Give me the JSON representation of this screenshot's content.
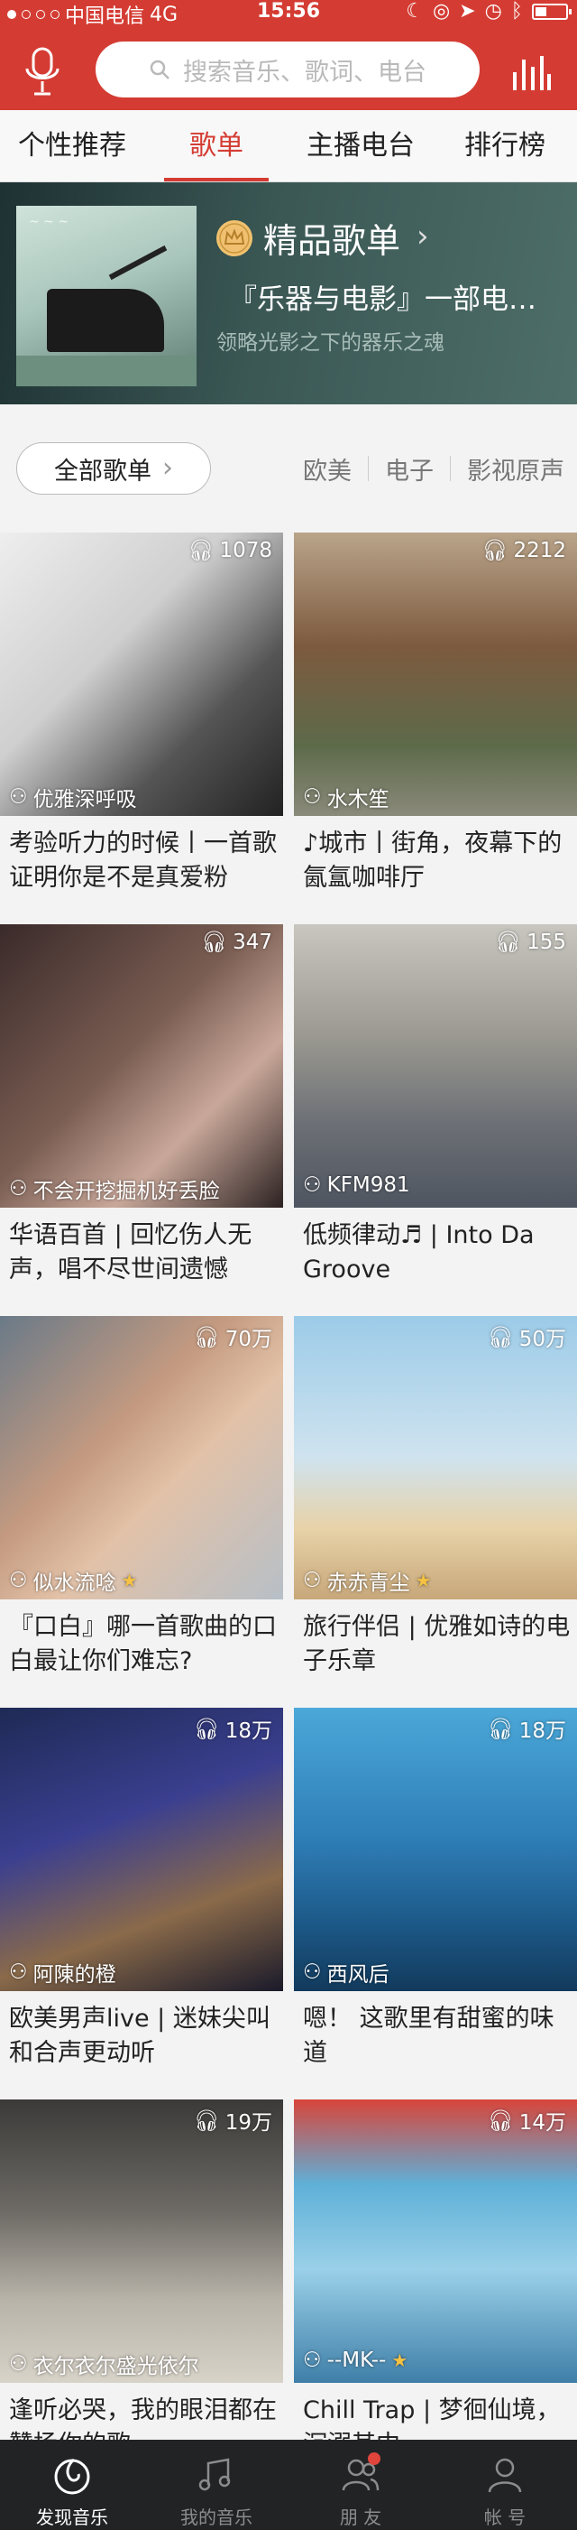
{
  "status_bar": {
    "carrier": "中国电信",
    "network": "4G",
    "time": "15:56"
  },
  "header": {
    "search_placeholder": "搜索音乐、歌词、电台",
    "accent_color": "#d43c33"
  },
  "tabs": [
    {
      "label": "个性推荐",
      "active": false
    },
    {
      "label": "歌单",
      "active": true
    },
    {
      "label": "主播电台",
      "active": false
    },
    {
      "label": "排行榜",
      "active": false
    }
  ],
  "banner": {
    "title": "精品歌单",
    "subtitle": "『乐器与电影』一部电影的声音",
    "description": "领略光影之下的器乐之魂",
    "icon": "crown-icon"
  },
  "filter": {
    "all_label": "全部歌单",
    "categories": [
      "欧美",
      "电子",
      "影视原声"
    ]
  },
  "playlists": [
    {
      "plays": "1078",
      "creator": "优雅深呼吸",
      "vip": false,
      "title": "考验听力的时候丨一首歌证明你是不是真爱粉"
    },
    {
      "plays": "2212",
      "creator": "水木笙",
      "vip": false,
      "title": "♪城市丨街角，夜幕下的氤氲咖啡厅"
    },
    {
      "plays": "347",
      "creator": "不会开挖掘机好丢脸",
      "vip": false,
      "title": "华语百首 | 回忆伤人无声，唱不尽世间遗憾"
    },
    {
      "plays": "155",
      "creator": "KFM981",
      "vip": false,
      "title": "低频律动♬ | Into Da Groove"
    },
    {
      "plays": "70万",
      "creator": "似水流唸",
      "vip": true,
      "title": "『口白』哪一首歌曲的口白最让你们难忘?"
    },
    {
      "plays": "50万",
      "creator": "赤赤青尘",
      "vip": true,
      "title": "旅行伴侣 | 优雅如诗的电子乐章"
    },
    {
      "plays": "18万",
      "creator": "阿陳的橙",
      "vip": false,
      "title": "欧美男声live | 迷妹尖叫和合声更动听"
    },
    {
      "plays": "18万",
      "creator": "西风后",
      "vip": false,
      "title": "嗯！ 这歌里有甜蜜的味道"
    },
    {
      "plays": "19万",
      "creator": "衣尔衣尔盛光依尔",
      "vip": false,
      "title": "逢听必哭，我的眼泪都在赞扬你的歌"
    },
    {
      "plays": "14万",
      "creator": "--MK--",
      "vip": true,
      "title": "Chill Trap | 梦徊仙境，沉溺其中"
    }
  ],
  "bottom_nav": [
    {
      "label": "发现音乐",
      "icon": "discover-music-icon",
      "active": true
    },
    {
      "label": "我的音乐",
      "icon": "my-music-icon",
      "active": false
    },
    {
      "label": "朋 友",
      "icon": "friends-icon",
      "active": false
    },
    {
      "label": "帐 号",
      "icon": "account-icon",
      "active": false
    }
  ]
}
